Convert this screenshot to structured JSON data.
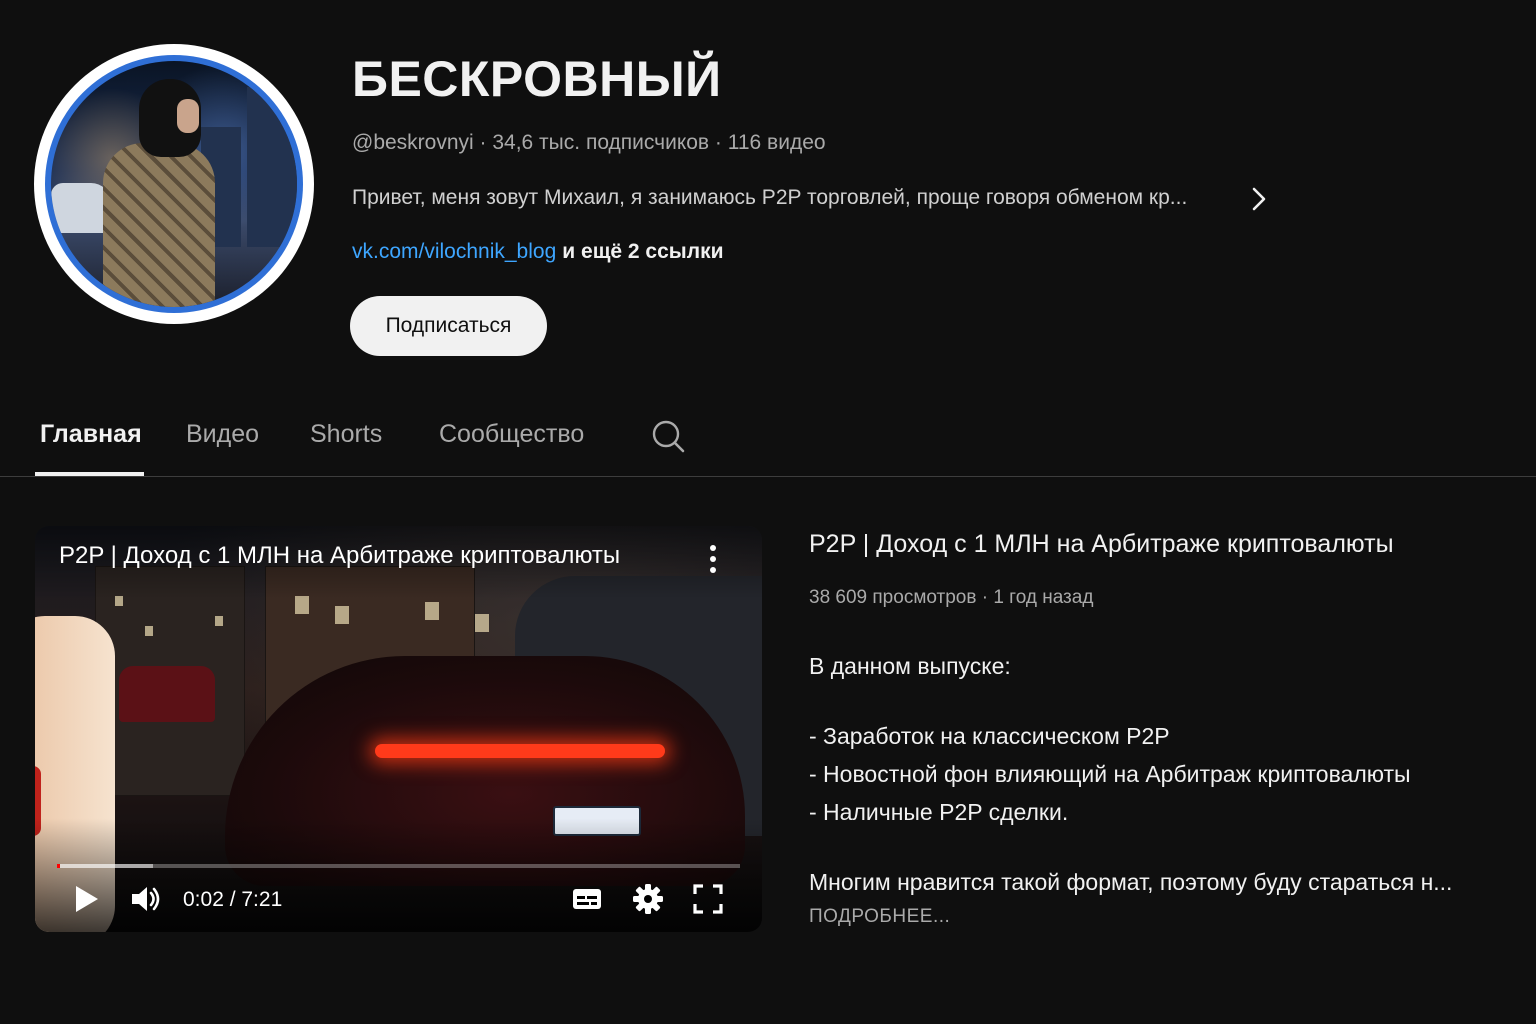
{
  "channel": {
    "name": "БЕСКРОВНЫЙ",
    "meta": "@beskrovnyi · 34,6 тыс. подписчиков · 116 видео",
    "description": "Привет, меня зовут Михаил, я занимаюсь P2P торговлей, проще говоря обменом кр...",
    "link": "vk.com/vilochnik_blog",
    "more_links": "и ещё 2 ссылки",
    "subscribe_label": "Подписаться"
  },
  "tabs": [
    {
      "label": "Главная",
      "active": true
    },
    {
      "label": "Видео",
      "active": false
    },
    {
      "label": "Shorts",
      "active": false
    },
    {
      "label": "Сообщество",
      "active": false
    }
  ],
  "player": {
    "title": "P2P | Доход с 1 МЛН на Арбитраже криптовалюты",
    "time": "0:02 / 7:21",
    "progress_fraction": 0.005,
    "buffered_fraction": 0.14
  },
  "video": {
    "title": "P2P | Доход с 1 МЛН на Арбитраже криптовалюты",
    "stats": "38 609 просмотров · 1 год назад",
    "desc_intro": "В данном выпуске:",
    "desc_items": [
      "- Заработок на классическом P2P",
      "- Новостной фон влияющий на Арбитраж криптовалюты",
      "- Наличные P2P сделки."
    ],
    "desc_last": "Многим нравится такой формат, поэтому буду стараться н...",
    "read_more": "ПОДРОБНЕЕ..."
  },
  "colors": {
    "background": "#0f0f0f",
    "link": "#3ea6ff",
    "avatar_ring": "#2f6fd6",
    "progress": "#ff0000"
  },
  "icons": [
    "chevron-right-icon",
    "search-icon",
    "more-vert-icon",
    "play-icon",
    "volume-icon",
    "subtitles-icon",
    "settings-icon",
    "fullscreen-icon"
  ]
}
